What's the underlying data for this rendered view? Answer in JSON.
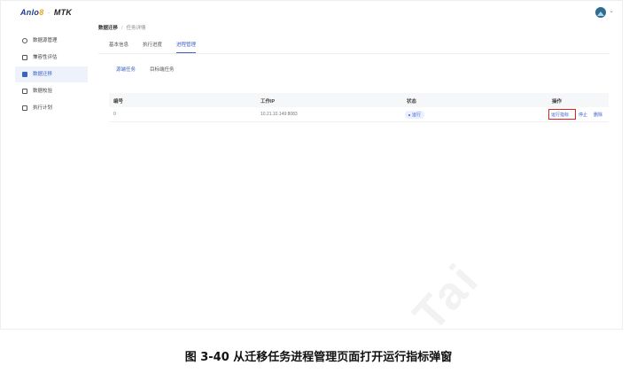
{
  "app": {
    "logo_brand_a": "Anlo",
    "logo_brand_b": "8",
    "logo_separator": "·",
    "logo_product": "MTK"
  },
  "sidebar": {
    "items": [
      {
        "label": "数据源管理",
        "icon": "database-icon",
        "active": false
      },
      {
        "label": "兼容性评估",
        "icon": "assessment-icon",
        "active": false
      },
      {
        "label": "数据迁移",
        "icon": "folder-icon",
        "active": true
      },
      {
        "label": "数据校验",
        "icon": "copy-icon",
        "active": false
      },
      {
        "label": "执行计划",
        "icon": "calendar-icon",
        "active": false
      }
    ]
  },
  "breadcrumb": {
    "first": "数据迁移",
    "separator": "/",
    "second": "任务详情"
  },
  "tabs": [
    {
      "label": "基本信息",
      "active": false
    },
    {
      "label": "执行进度",
      "active": false
    },
    {
      "label": "进程管理",
      "active": true
    }
  ],
  "subtabs": [
    {
      "label": "源端任务",
      "active": true
    },
    {
      "label": "目标端任务",
      "active": false
    }
  ],
  "table": {
    "columns": [
      "编号",
      "工作IP",
      "状态",
      "操作"
    ],
    "rows": [
      {
        "id": "0",
        "ip": "10.21.10.149:8083",
        "status": "运行",
        "actions": [
          "运行指标",
          "停止",
          "删除"
        ]
      }
    ]
  },
  "watermark": "Tai",
  "caption": "图 3-40  从迁移任务进程管理页面打开运行指标弹窗",
  "colors": {
    "accent": "#3b62c7",
    "highlight": "#e02020",
    "brand": "#1f3a8a"
  }
}
